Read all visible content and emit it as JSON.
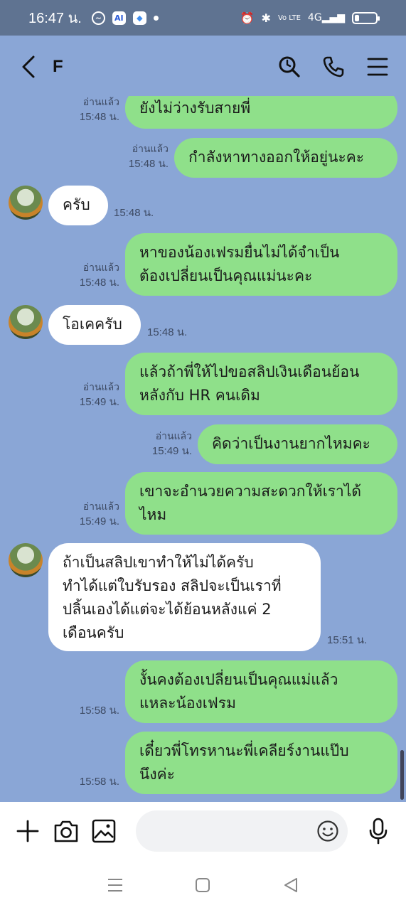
{
  "status_bar": {
    "time": "16:47 น.",
    "network": "4G"
  },
  "header": {
    "contact_name": "F"
  },
  "messages": [
    {
      "id": 0,
      "dir": "out",
      "lines": [
        "ยังไม่ว่างรับสายพี่"
      ],
      "read": "อ่านแล้ว",
      "time": "15:48 น."
    },
    {
      "id": 1,
      "dir": "out",
      "lines": [
        "กำลังหาทางออกให้อยู่นะคะ"
      ],
      "read": "อ่านแล้ว",
      "time": "15:48 น."
    },
    {
      "id": 2,
      "dir": "in",
      "lines": [
        "ครับ"
      ],
      "time": "15:48 น."
    },
    {
      "id": 3,
      "dir": "out",
      "lines": [
        "หาของน้องเฟรมยื่นไม่ได้จำเป็น",
        "ต้องเปลี่ยนเป็นคุณแม่นะคะ"
      ],
      "read": "อ่านแล้ว",
      "time": "15:48 น."
    },
    {
      "id": 4,
      "dir": "in",
      "lines": [
        "โอเคครับ"
      ],
      "time": "15:48 น."
    },
    {
      "id": 5,
      "dir": "out",
      "lines": [
        "แล้วถ้าพี่ให้ไปขอสลิปเงินเดือนย้อน",
        "หลังกับ HR คนเดิม"
      ],
      "read": "อ่านแล้ว",
      "time": "15:49 น."
    },
    {
      "id": 6,
      "dir": "out",
      "lines": [
        "คิดว่าเป็นงานยากไหมคะ"
      ],
      "read": "อ่านแล้ว",
      "time": "15:49 น."
    },
    {
      "id": 7,
      "dir": "out",
      "lines": [
        "เขาจะอำนวยความสะดวกให้เราได้",
        "ไหม"
      ],
      "read": "อ่านแล้ว",
      "time": "15:49 น."
    },
    {
      "id": 8,
      "dir": "in",
      "lines": [
        "ถ้าเป็นสลิปเขาทำให้ไม่ได้ครับ",
        "ทำได้แต่ใบรับรอง สลิปจะเป็นเราที่",
        "ปลิ้นเองได้แต่จะได้ย้อนหลังแค่ 2",
        "เดือนครับ"
      ],
      "time": "15:51 น."
    },
    {
      "id": 9,
      "dir": "out",
      "lines": [
        "งั้นคงต้องเปลี่ยนเป็นคุณแม่แล้ว",
        "แหละน้องเฟรม"
      ],
      "time": "15:58 น."
    },
    {
      "id": 10,
      "dir": "out",
      "lines": [
        "เดี๋ยวพี่โทรหานะพี่เคลียร์งานแป๊บ",
        "นึงค่ะ"
      ],
      "time": "15:58 น."
    }
  ],
  "input": {
    "placeholder": ""
  },
  "colors": {
    "chat_background": "#8aa6d6",
    "outgoing_bubble": "#8fe08a",
    "incoming_bubble": "#ffffff",
    "status_bar": "#5f7391"
  },
  "icons": [
    "back-icon",
    "search-icon",
    "phone-icon",
    "menu-icon",
    "plus-icon",
    "camera-icon",
    "image-icon",
    "emoji-icon",
    "mic-icon",
    "nav-recents-icon",
    "nav-home-icon",
    "nav-back-icon"
  ]
}
